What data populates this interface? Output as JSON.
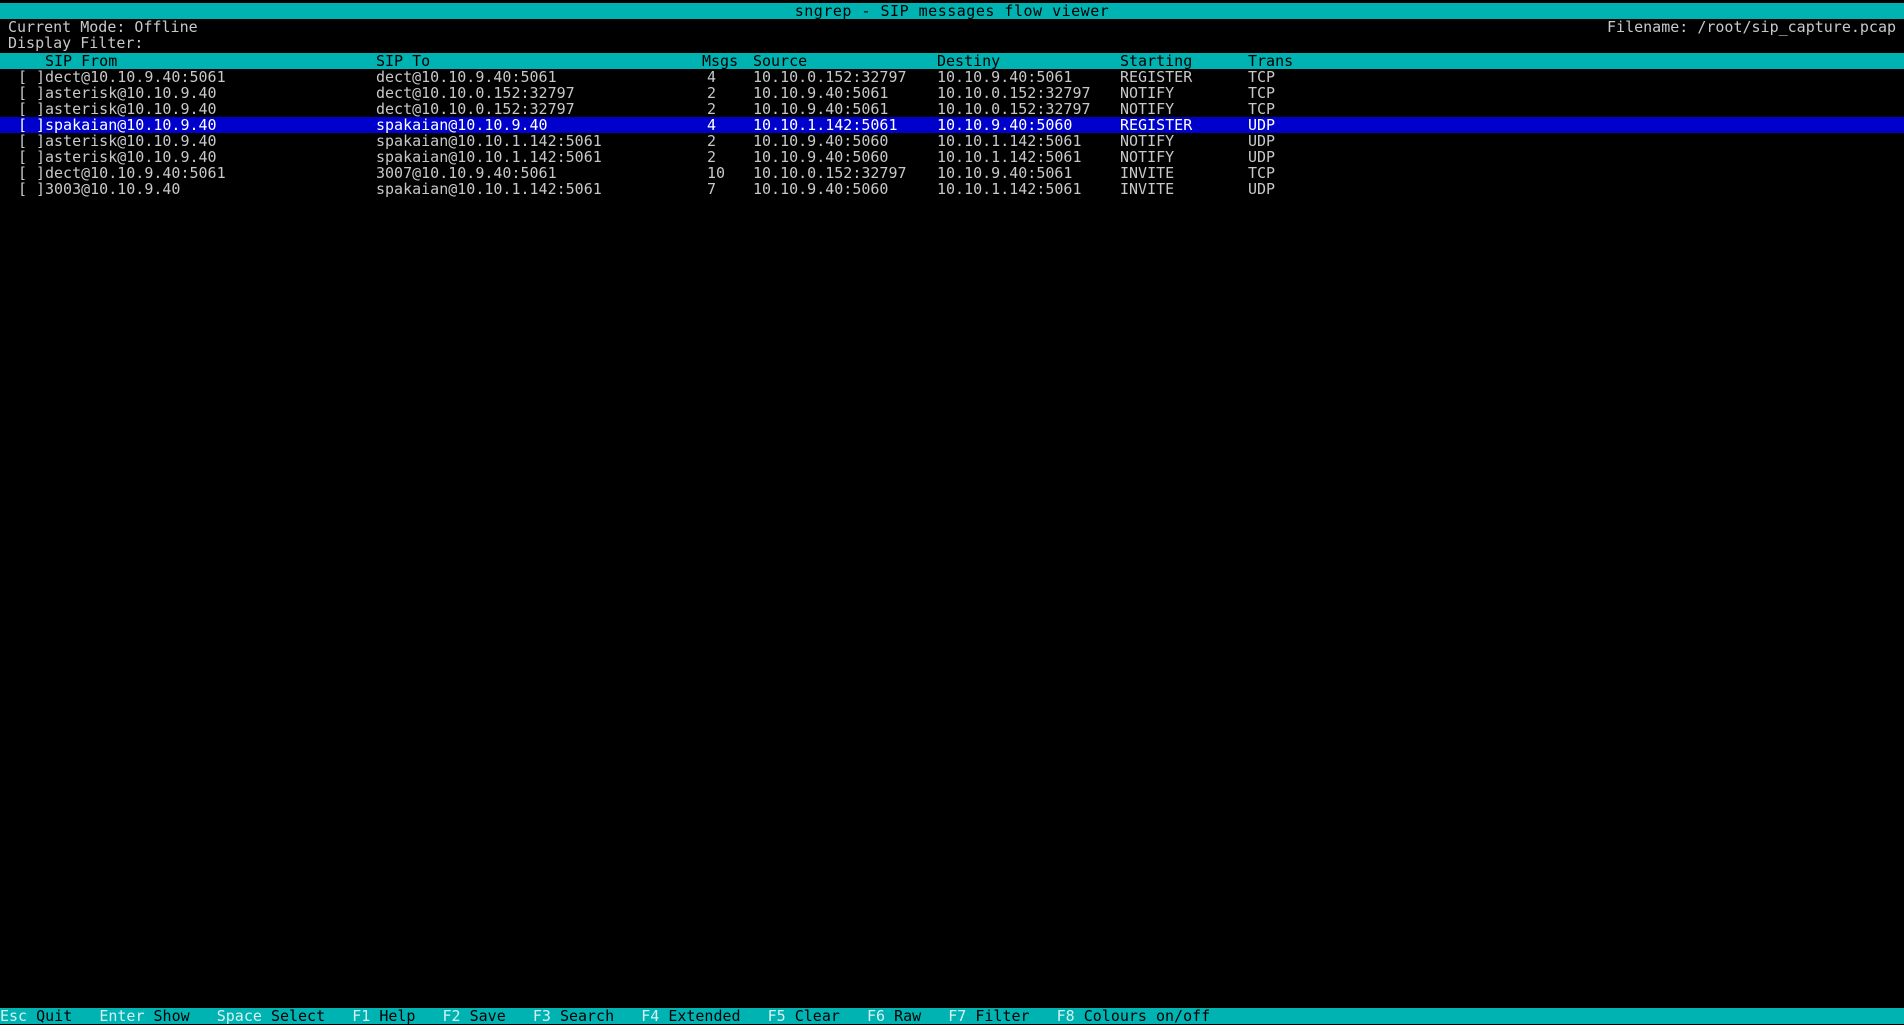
{
  "window": {
    "title": "sngrep - SIP messages flow viewer",
    "background": "#000000",
    "accent": "#00b3b3",
    "selection": "#0000cc"
  },
  "header": {
    "mode_label": "Current Mode: Offline",
    "filter_label": "Display Filter:",
    "filter_value": "",
    "filename_label": "Filename: /root/sip_capture.pcap"
  },
  "call_list": {
    "columns": [
      {
        "key": "check",
        "label": ""
      },
      {
        "key": "from",
        "label": "SIP From"
      },
      {
        "key": "to",
        "label": "SIP To"
      },
      {
        "key": "msgs",
        "label": "Msgs"
      },
      {
        "key": "src",
        "label": "Source"
      },
      {
        "key": "dst",
        "label": "Destiny"
      },
      {
        "key": "start",
        "label": "Starting"
      },
      {
        "key": "trans",
        "label": "Trans"
      }
    ],
    "rows": [
      {
        "check": "[ ]",
        "from": "dect@10.10.9.40:5061",
        "to": "dect@10.10.9.40:5061",
        "msgs": "4",
        "src": "10.10.0.152:32797",
        "dst": "10.10.9.40:5061",
        "start": "REGISTER",
        "trans": "TCP",
        "selected": false
      },
      {
        "check": "[ ]",
        "from": "asterisk@10.10.9.40",
        "to": "dect@10.10.0.152:32797",
        "msgs": "2",
        "src": "10.10.9.40:5061",
        "dst": "10.10.0.152:32797",
        "start": "NOTIFY",
        "trans": "TCP",
        "selected": false
      },
      {
        "check": "[ ]",
        "from": "asterisk@10.10.9.40",
        "to": "dect@10.10.0.152:32797",
        "msgs": "2",
        "src": "10.10.9.40:5061",
        "dst": "10.10.0.152:32797",
        "start": "NOTIFY",
        "trans": "TCP",
        "selected": false
      },
      {
        "check": "[ ]",
        "from": "spakaian@10.10.9.40",
        "to": "spakaian@10.10.9.40",
        "msgs": "4",
        "src": "10.10.1.142:5061",
        "dst": "10.10.9.40:5060",
        "start": "REGISTER",
        "trans": "UDP",
        "selected": true
      },
      {
        "check": "[ ]",
        "from": "asterisk@10.10.9.40",
        "to": "spakaian@10.10.1.142:5061",
        "msgs": "2",
        "src": "10.10.9.40:5060",
        "dst": "10.10.1.142:5061",
        "start": "NOTIFY",
        "trans": "UDP",
        "selected": false
      },
      {
        "check": "[ ]",
        "from": "asterisk@10.10.9.40",
        "to": "spakaian@10.10.1.142:5061",
        "msgs": "2",
        "src": "10.10.9.40:5060",
        "dst": "10.10.1.142:5061",
        "start": "NOTIFY",
        "trans": "UDP",
        "selected": false
      },
      {
        "check": "[ ]",
        "from": "dect@10.10.9.40:5061",
        "to": "3007@10.10.9.40:5061",
        "msgs": "10",
        "src": "10.10.0.152:32797",
        "dst": "10.10.9.40:5061",
        "start": "INVITE",
        "trans": "TCP",
        "selected": false
      },
      {
        "check": "[ ]",
        "from": "3003@10.10.9.40",
        "to": "spakaian@10.10.1.142:5061",
        "msgs": "7",
        "src": "10.10.9.40:5060",
        "dst": "10.10.1.142:5061",
        "start": "INVITE",
        "trans": "UDP",
        "selected": false
      }
    ]
  },
  "keybar": {
    "items": [
      {
        "key": "Esc",
        "label": "Quit"
      },
      {
        "key": "Enter",
        "label": "Show"
      },
      {
        "key": "Space",
        "label": "Select"
      },
      {
        "key": "F1",
        "label": "Help"
      },
      {
        "key": "F2",
        "label": "Save"
      },
      {
        "key": "F3",
        "label": "Search"
      },
      {
        "key": "F4",
        "label": "Extended"
      },
      {
        "key": "F5",
        "label": "Clear"
      },
      {
        "key": "F6",
        "label": "Raw"
      },
      {
        "key": "F7",
        "label": "Filter"
      },
      {
        "key": "F8",
        "label": "Colours on/off"
      }
    ]
  }
}
